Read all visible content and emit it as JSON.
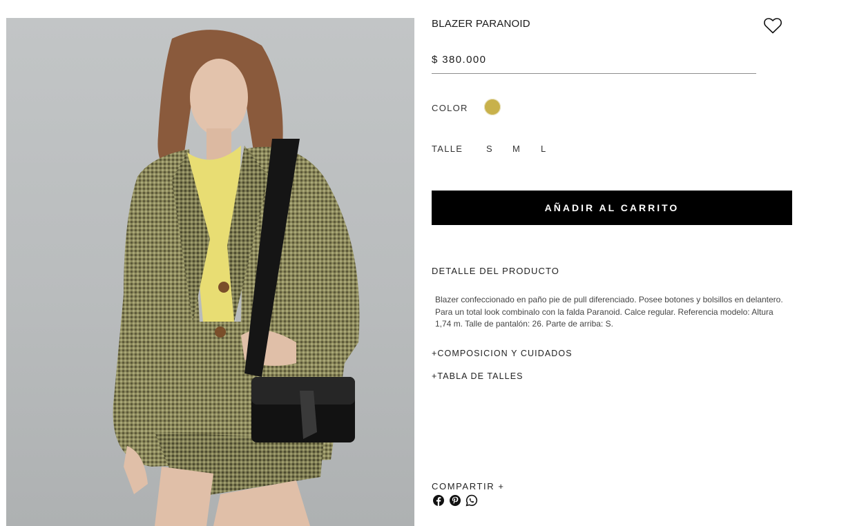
{
  "product": {
    "title": "BLAZER PARANOID",
    "price": "$ 380.000",
    "color_label": "COLOR",
    "color_swatch": "#c8b14b",
    "size_label": "TALLE",
    "sizes": [
      "S",
      "M",
      "L"
    ],
    "add_to_cart": "AÑADIR AL CARRITO",
    "detail_heading": "DETALLE DEL PRODUCTO",
    "description": "Blazer confeccionado en paño pie de pull diferenciado. Posee botones y bolsillos en delantero. Para un total look combinalo con la falda Paranoid. Calce regular. Referencia modelo: Altura 1,74 m. Talle de pantalón: 26. Parte de arriba: S.",
    "accordions": [
      "+COMPOSICION Y CUIDADOS",
      "+TABLA DE TALLES"
    ]
  },
  "share": {
    "label": "COMPARTIR +",
    "icons": [
      "facebook-icon",
      "pinterest-icon",
      "whatsapp-icon"
    ]
  },
  "icons": {
    "favorite": "heart-outline-icon"
  },
  "colors": {
    "button_bg": "#000000",
    "button_text": "#ffffff",
    "swatch": "#c8b14b"
  }
}
